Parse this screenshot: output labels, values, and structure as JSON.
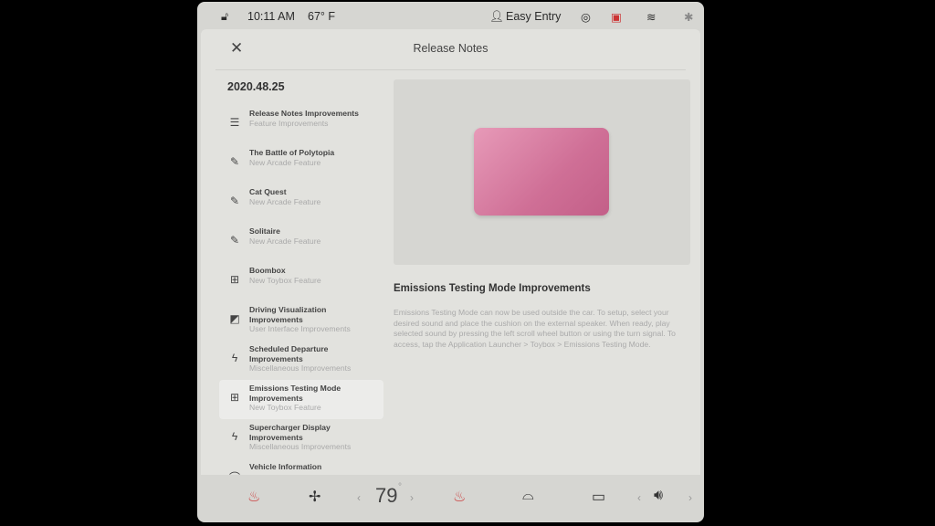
{
  "status": {
    "time": "10:11 AM",
    "temperature": "67° F",
    "profile": "Easy Entry",
    "icons": [
      "lock-open-icon",
      "person-icon",
      "sentry-icon",
      "dashcam-icon",
      "wifi-icon",
      "bluetooth-icon"
    ]
  },
  "header": {
    "title": "Release Notes",
    "close": "✕"
  },
  "version": "2020.48.25",
  "items": [
    {
      "title": "Release Notes Improvements",
      "subtitle": "Feature Improvements",
      "icon": "list-icon"
    },
    {
      "title": "The Battle of Polytopia",
      "subtitle": "New Arcade Feature",
      "icon": "game-controller-icon"
    },
    {
      "title": "Cat Quest",
      "subtitle": "New Arcade Feature",
      "icon": "game-controller-icon"
    },
    {
      "title": "Solitaire",
      "subtitle": "New Arcade Feature",
      "icon": "game-controller-icon"
    },
    {
      "title": "Boombox",
      "subtitle": "New Toybox Feature",
      "icon": "toybox-icon"
    },
    {
      "title": "Driving Visualization Improvements",
      "subtitle": "User Interface Improvements",
      "icon": "display-icon"
    },
    {
      "title": "Scheduled Departure Improvements",
      "subtitle": "Miscellaneous Improvements",
      "icon": "bolt-icon"
    },
    {
      "title": "Emissions Testing Mode Improvements",
      "subtitle": "New Toybox Feature",
      "icon": "toybox-icon",
      "selected": true
    },
    {
      "title": "Supercharger Display Improvements",
      "subtitle": "Miscellaneous Improvements",
      "icon": "bolt-icon"
    },
    {
      "title": "Vehicle Information",
      "subtitle": "",
      "icon": "gauge-icon"
    }
  ],
  "detail": {
    "heading": "Emissions Testing Mode Improvements",
    "body": "Emissions Testing Mode can now be used outside the car. To setup, select your desired sound and place the cushion on the external speaker. When ready, play selected sound by pressing the left scroll wheel button or using the turn signal. To access, tap the Application Launcher > Toybox > Emissions Testing Mode."
  },
  "climate": {
    "temperature": "79",
    "degree": "°"
  },
  "colors": {
    "accent_pink": "#d9789f",
    "heat": "#d0453f"
  }
}
